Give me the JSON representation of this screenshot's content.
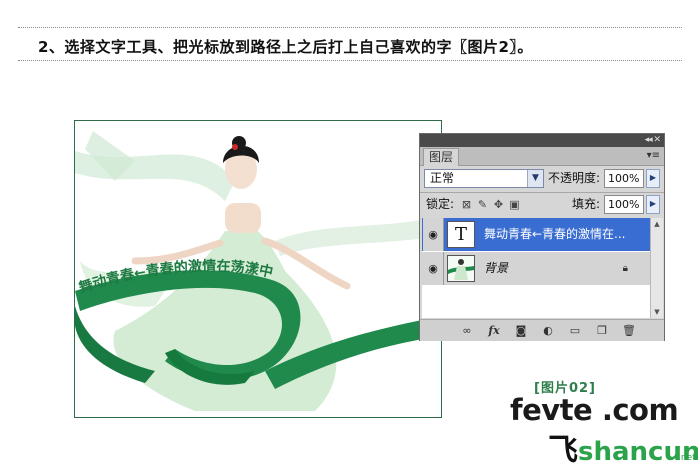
{
  "instruction": "2、选择文字工具、把光标放到路径上之后打上自己喜欢的字〖图片2〗。",
  "photo": {
    "path_text": "舞动青春←青春的激情在荡漾中"
  },
  "panel": {
    "collapse_glyph": "◂◂ ✕",
    "tab_label": "图层",
    "menu_glyph": "▾≡",
    "blend_mode": "正常",
    "opacity_label": "不透明度:",
    "opacity_value": "100%",
    "lock_label": "锁定:",
    "fill_label": "填充:",
    "fill_value": "100%",
    "layers": [
      {
        "name": "舞动青春←青春的激情在...",
        "type": "text",
        "selected": true,
        "thumb": "T"
      },
      {
        "name": "背景",
        "type": "background",
        "selected": false
      }
    ],
    "footer_icons": [
      "link-icon",
      "fx-icon",
      "mask-icon",
      "adjustment-icon",
      "group-folder-icon",
      "new-layer-icon",
      "trash-icon"
    ]
  },
  "caption": "[图片02]",
  "logo": {
    "top": "fevte .com",
    "bottom_prefix": "飞",
    "bottom_domain": "shancun",
    "bottom_suffix": ".net"
  },
  "colors": {
    "selection_blue": "#3a6dd1",
    "ribbon_green": "#1f8a4c",
    "text_green": "#2e7d4a"
  }
}
